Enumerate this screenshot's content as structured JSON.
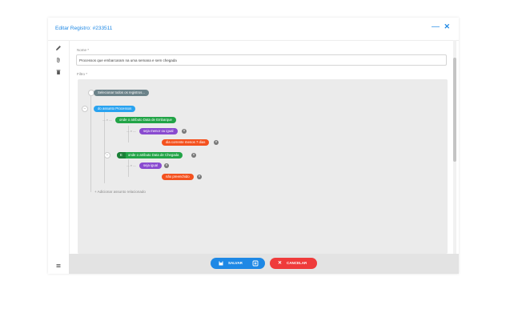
{
  "dialog": {
    "title": "Editar Registro: #233511",
    "minimize_icon": "minus-icon",
    "close_icon": "close-icon"
  },
  "sidebar": {
    "icons": [
      "pencil-icon",
      "paperclip-icon",
      "trash-icon",
      "menu-icon"
    ]
  },
  "form": {
    "name_label": "Nome *",
    "name_value": "Processos que embarcaram na uma semana e sem chegada",
    "filter_label": "Filtro *"
  },
  "filter": {
    "select_all": "Selecionar todos os registros...",
    "subject": "do assunto Processos",
    "group1": {
      "connector": "— e —",
      "attribute": "onde o atributo Data de Embarque",
      "inner_connector": "— e —",
      "operator": "seja menor ou igual",
      "value": "dia corrente menos 7 dias"
    },
    "group2": {
      "connector": "— e —",
      "negate": "E",
      "attribute": "onde o atributo Data de Chegada",
      "inner_connector": "— e —",
      "operator": "seja igual",
      "value": "não preenchido"
    },
    "add_related": "+ Adicionar assunto relacionado"
  },
  "footer": {
    "save_label": "SALVAR",
    "cancel_label": "CANCELAR"
  },
  "colors": {
    "accent": "#1e88e5",
    "danger": "#ef3b3b",
    "green": "#22a447",
    "purple": "#8a4bd0",
    "orange": "#f4511e"
  }
}
